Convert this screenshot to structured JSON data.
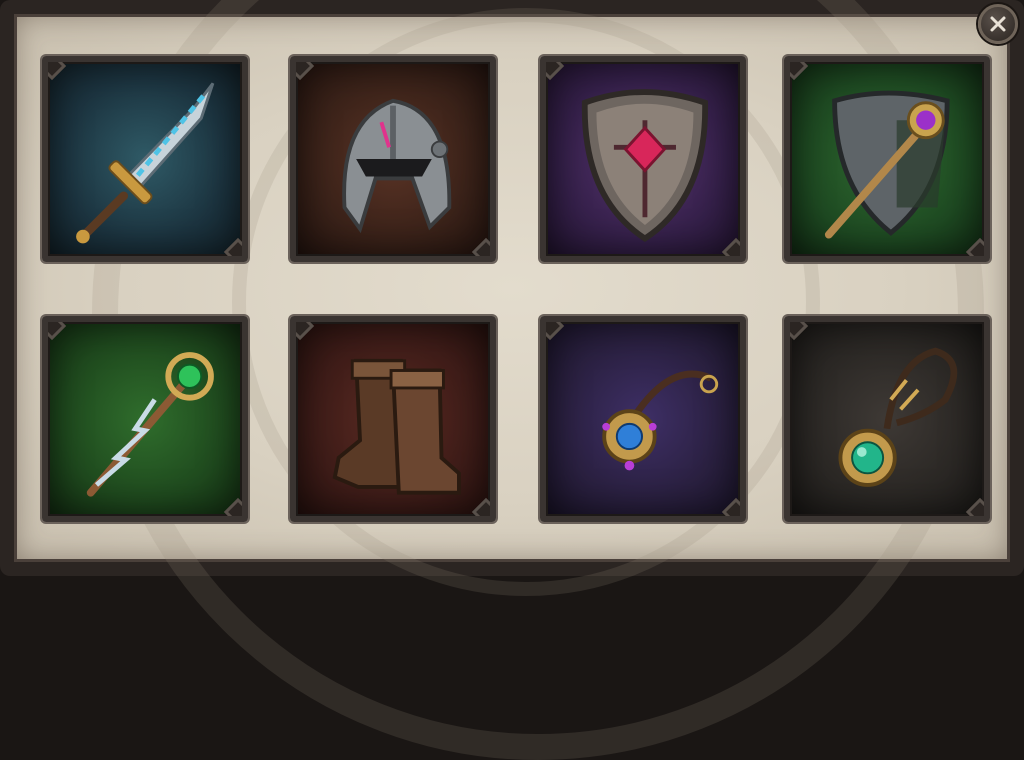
{
  "window": {
    "close_icon": "close-icon"
  },
  "colors": {
    "frame": "#2b2522",
    "parchment": "#dcd4c4",
    "slot_border": "#3a3431"
  },
  "inventory": {
    "slots": [
      {
        "item": "sword",
        "icon": "sword-icon",
        "bg": "#1c3440"
      },
      {
        "item": "helmet",
        "icon": "helmet-icon",
        "bg": "#3a2219"
      },
      {
        "item": "shield",
        "icon": "shield-icon",
        "bg": "#35204a"
      },
      {
        "item": "shield-with-staff",
        "icon": "shield-staff-icon",
        "bg": "#1e4a22"
      },
      {
        "item": "staff",
        "icon": "staff-icon",
        "bg": "#1f4a1e"
      },
      {
        "item": "boots",
        "icon": "boots-icon",
        "bg": "#3e1c18"
      },
      {
        "item": "amulet",
        "icon": "amulet-icon",
        "bg": "#2a2040"
      },
      {
        "item": "pendant",
        "icon": "pendant-icon",
        "bg": "#2a2724"
      }
    ]
  }
}
